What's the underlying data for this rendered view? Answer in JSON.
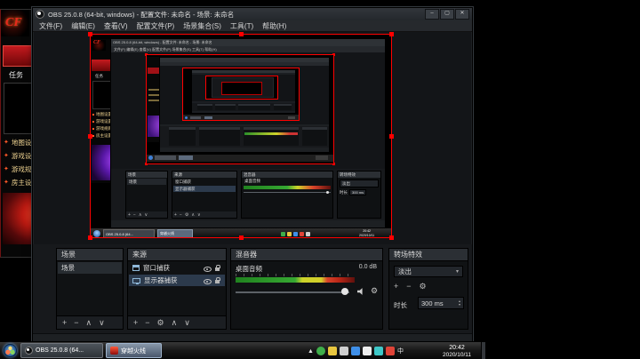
{
  "obs": {
    "title": "OBS 25.0.8 (64-bit, windows) - 配置文件: 未命名 - 场景: 未命名",
    "window_buttons": {
      "minimize": "–",
      "maximize": "▢",
      "close": "✕"
    },
    "menus": [
      "文件(F)",
      "编辑(E)",
      "查看(V)",
      "配置文件(P)",
      "场景集合(S)",
      "工具(T)",
      "帮助(H)"
    ],
    "menu_line": "文件(F)  编辑(E)  查看(V)  配置文件(P)  场景集合(S)  工具(T)  帮助(H)",
    "scenes": {
      "title": "场景",
      "items": [
        {
          "label": "场景"
        }
      ]
    },
    "sources": {
      "title": "来源",
      "items": [
        {
          "label": "窗口捕获"
        },
        {
          "label": "显示器捕获"
        }
      ]
    },
    "mixer": {
      "title": "混音器",
      "channel": "桌面音频",
      "db": "0.0 dB"
    },
    "transitions": {
      "title": "转场特效",
      "selected": "淡出",
      "duration_label": "时长",
      "duration_value": "300 ms"
    }
  },
  "game": {
    "logo": "CF",
    "task_label": "任务",
    "menu_items": [
      "地图设置",
      "游戏设置",
      "游戏规则",
      "房主设置"
    ]
  },
  "taskbar": {
    "buttons": [
      {
        "label": "OBS 25.0.8 (64..."
      },
      {
        "label": "穿越火线"
      }
    ],
    "clock_time": "20:42",
    "clock_date": "2020/10/11",
    "tray_arrow": "▲",
    "ime": "中"
  },
  "glyphs": {
    "plus": "+",
    "minus": "−",
    "up": "∧",
    "down": "∨",
    "gear": "⚙",
    "dropdown": "▾",
    "spin_up": "▴",
    "spin_down": "▾"
  },
  "colors": {
    "selection": "#ff0000",
    "meter_green": "#36a832"
  }
}
